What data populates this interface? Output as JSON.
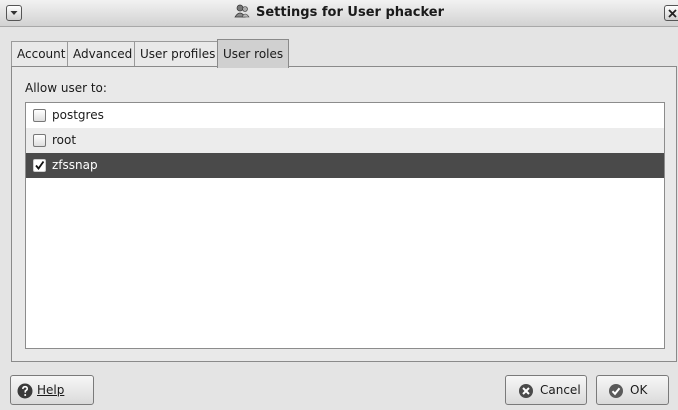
{
  "window": {
    "title": "Settings for User phacker"
  },
  "tabs": [
    {
      "label": "Account"
    },
    {
      "label": "Advanced"
    },
    {
      "label": "User profiles"
    },
    {
      "label": "User roles"
    }
  ],
  "active_tab": "User roles",
  "roles": {
    "heading": "Allow user to:",
    "items": [
      {
        "label": "postgres",
        "checked": false,
        "selected": false
      },
      {
        "label": "root",
        "checked": false,
        "selected": false
      },
      {
        "label": "zfssnap",
        "checked": true,
        "selected": true
      }
    ]
  },
  "buttons": {
    "help": {
      "label": "Help",
      "icon": "help-icon"
    },
    "cancel": {
      "label": "Cancel",
      "icon": "cancel-icon"
    },
    "ok": {
      "label": "OK",
      "icon": "ok-icon"
    }
  },
  "colors": {
    "selection": "#4a4a4a",
    "window": "#e4e4e4"
  }
}
